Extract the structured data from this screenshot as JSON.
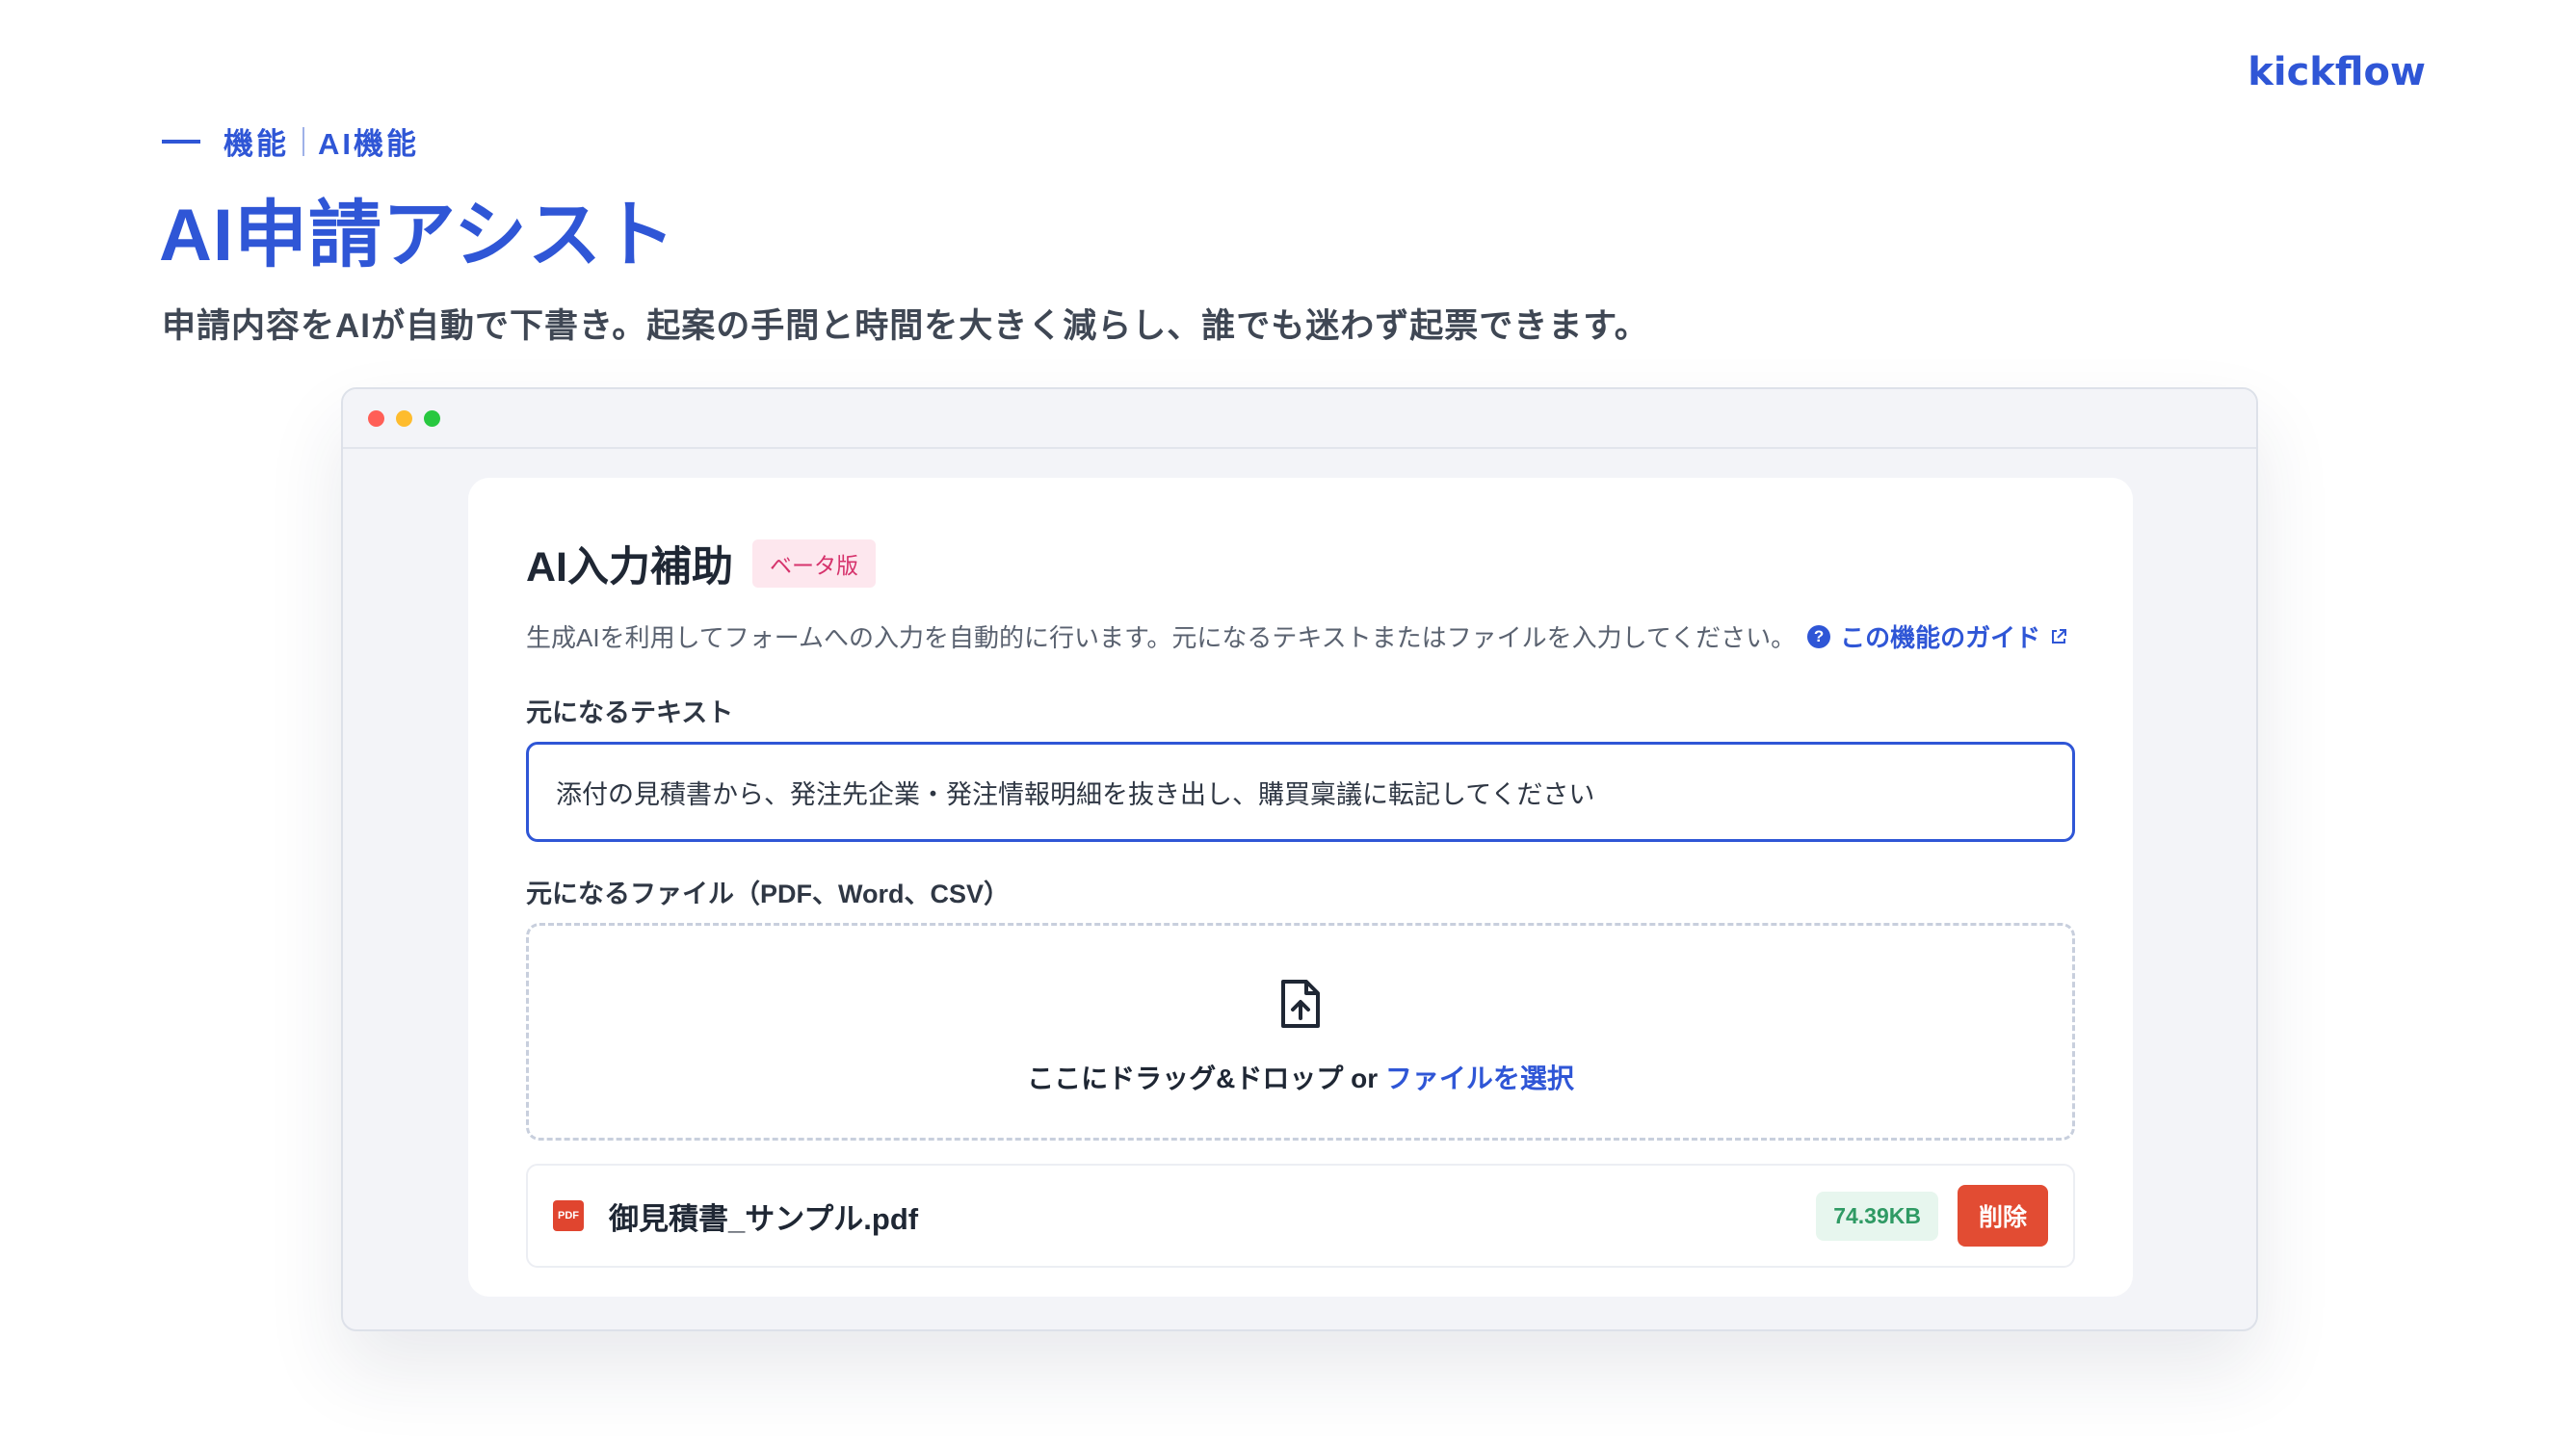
{
  "brand": {
    "logo_text": "kickflow",
    "color": "#2f56d6"
  },
  "header": {
    "breadcrumb": [
      "機能",
      "AI機能"
    ],
    "title": "AI申請アシスト",
    "lead": "申請内容をAIが自動で下書き。起案の手間と時間を大きく減らし、誰でも迷わず起票できます。"
  },
  "window": {
    "traffic_lights": [
      "#ff5f57",
      "#febc2e",
      "#28c840"
    ]
  },
  "panel": {
    "title": "AI入力補助",
    "badge": "ベータ版",
    "description": "生成AIを利用してフォームへの入力を自動的に行います。元になるテキストまたはファイルを入力してください。",
    "guide_link": "この機能のガイド",
    "text_label": "元になるテキスト",
    "text_value": "添付の見積書から、発注先企業・発注情報明細を抜き出し、購買稟議に転記してください",
    "file_label": "元になるファイル（PDF、Word、CSV）",
    "dropzone": {
      "prompt": "ここにドラッグ&ドロップ or ",
      "select_link": "ファイルを選択"
    },
    "file": {
      "type_icon": "PDF",
      "name": "御見積書_サンプル.pdf",
      "size": "74.39KB",
      "delete_label": "削除"
    }
  }
}
